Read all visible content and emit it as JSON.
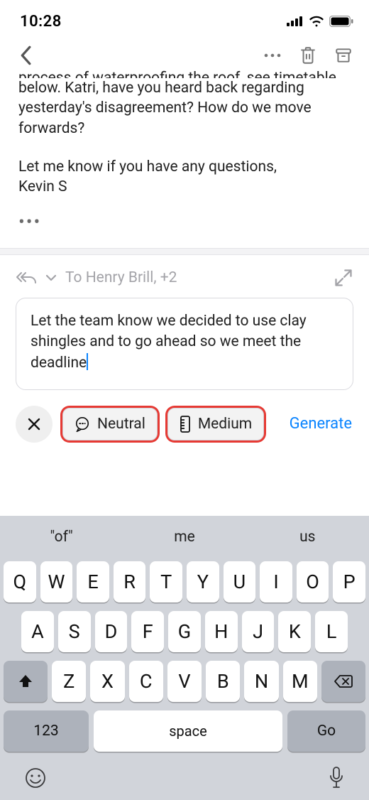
{
  "status": {
    "time": "10:28"
  },
  "email": {
    "truncated_line": "process of waterproofing the roof, see timetable",
    "body_line1": "below. Katri, have you heard back regarding yesterday's disagreement? How do we move forwards?",
    "signoff1": "Let me know if you have any questions,",
    "signoff2": "Kevin S"
  },
  "reply": {
    "to": "To Henry Brill, +2",
    "compose_text": "Let the team know we decided to use clay shingles and to go ahead so we meet the deadline"
  },
  "chips": {
    "neutral": "Neutral",
    "medium": "Medium",
    "generate": "Generate"
  },
  "keyboard": {
    "suggestions": [
      "\"of\"",
      "me",
      "us"
    ],
    "row1": [
      "Q",
      "W",
      "E",
      "R",
      "T",
      "Y",
      "U",
      "I",
      "O",
      "P"
    ],
    "row2": [
      "A",
      "S",
      "D",
      "F",
      "G",
      "H",
      "J",
      "K",
      "L"
    ],
    "row3": [
      "Z",
      "X",
      "C",
      "V",
      "B",
      "N",
      "M"
    ],
    "numbers_label": "123",
    "space_label": "space",
    "go_label": "Go"
  }
}
